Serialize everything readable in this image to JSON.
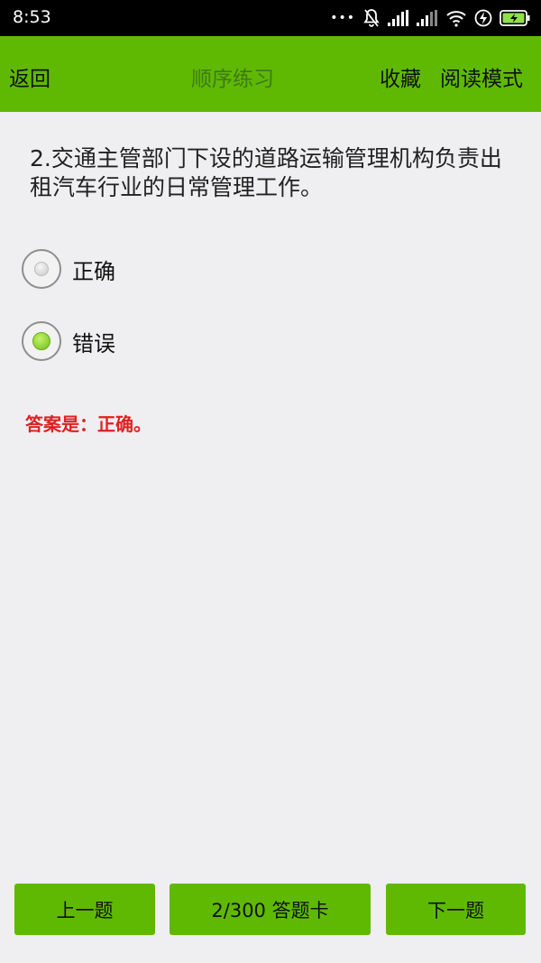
{
  "status": {
    "time": "8:53",
    "dots": "•••"
  },
  "header": {
    "back": "返回",
    "title": "顺序练习",
    "favorite": "收藏",
    "read_mode": "阅读模式"
  },
  "question": {
    "text": "2.交通主管部门下设的道路运输管理机构负责出租汽车行业的日常管理工作。"
  },
  "options": [
    {
      "label": "正确",
      "selected": false
    },
    {
      "label": "错误",
      "selected": true
    }
  ],
  "answer": {
    "text": "答案是：正确。"
  },
  "footer": {
    "prev": "上一题",
    "card": "2/300 答题卡",
    "next": "下一题"
  },
  "colors": {
    "accent": "#5fb902",
    "answer": "#e02020",
    "background": "#efeef0"
  }
}
